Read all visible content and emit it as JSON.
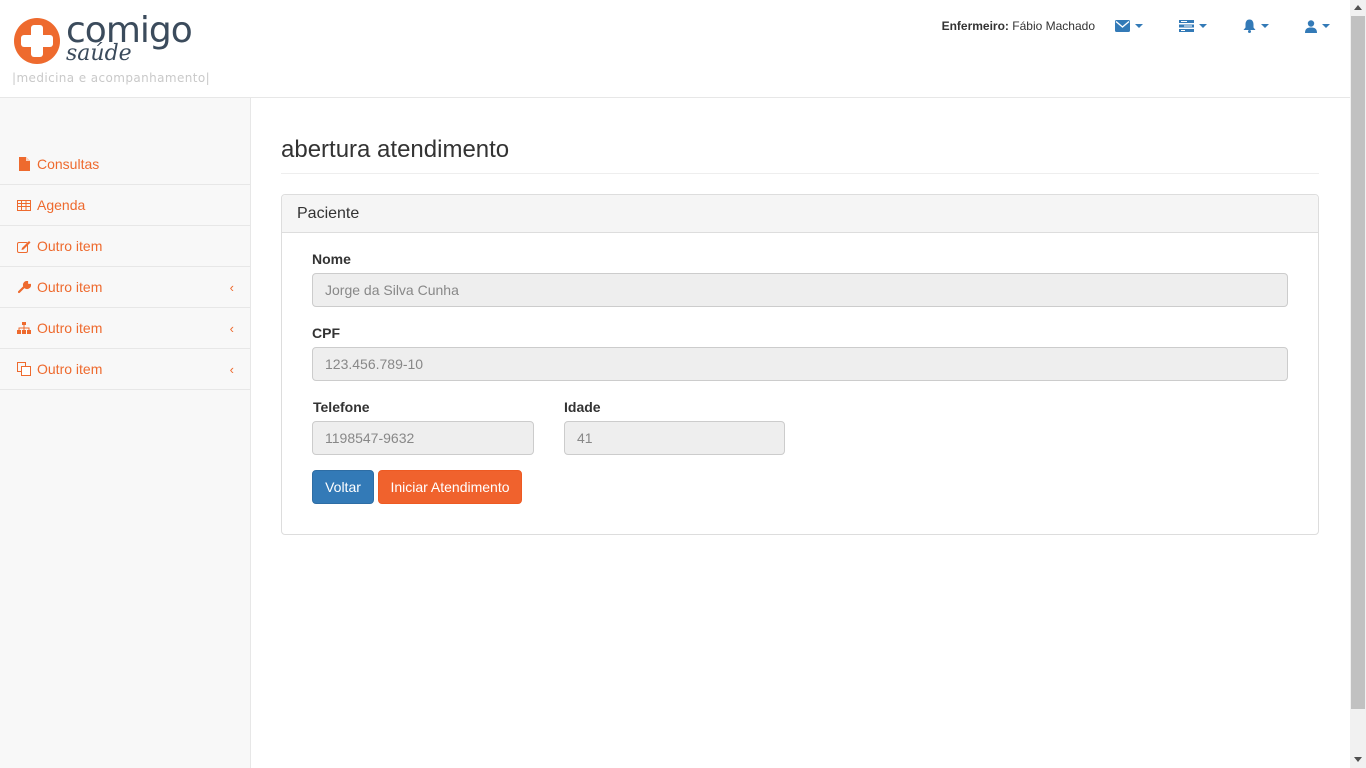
{
  "brand": {
    "name_main": "comigo",
    "name_sub": "saúde",
    "tagline": "|medicina e acompanhamento|",
    "colors": {
      "primary": "#3b4b5c",
      "accent": "#ee6a2e"
    }
  },
  "header": {
    "user_role": "Enfermeiro:",
    "user_name": "Fábio Machado",
    "menus": [
      {
        "icon": "envelope-icon"
      },
      {
        "icon": "tasks-icon"
      },
      {
        "icon": "bell-icon"
      },
      {
        "icon": "user-icon"
      }
    ]
  },
  "sidebar": {
    "items": [
      {
        "label": "Consultas",
        "icon": "file-icon",
        "has_submenu": false
      },
      {
        "label": "Agenda",
        "icon": "table-icon",
        "has_submenu": false
      },
      {
        "label": "Outro item",
        "icon": "edit-icon",
        "has_submenu": false
      },
      {
        "label": "Outro item",
        "icon": "wrench-icon",
        "has_submenu": true
      },
      {
        "label": "Outro item",
        "icon": "sitemap-icon",
        "has_submenu": true
      },
      {
        "label": "Outro item",
        "icon": "files-icon",
        "has_submenu": true
      }
    ],
    "submenu_arrow": "‹"
  },
  "main": {
    "page_title": "abertura atendimento",
    "panel": {
      "heading": "Paciente",
      "fields": {
        "nome": {
          "label": "Nome",
          "value": "Jorge da Silva Cunha"
        },
        "cpf": {
          "label": "CPF",
          "value": "123.456.789-10"
        },
        "telefone": {
          "label": "Telefone",
          "value": "1198547-9632"
        },
        "idade": {
          "label": "Idade",
          "value": "41"
        }
      },
      "buttons": {
        "back": "Voltar",
        "start": "Iniciar Atendimento"
      }
    }
  },
  "colors": {
    "link": "#ee6a2e",
    "primary_button": "#337ab7",
    "start_button": "#f0622d"
  }
}
